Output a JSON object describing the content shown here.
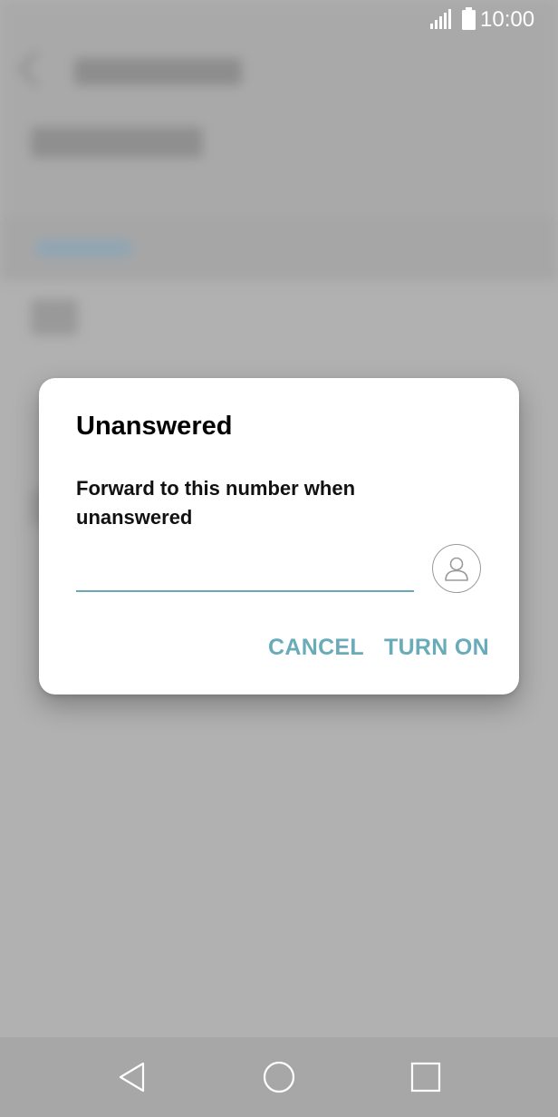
{
  "status_bar": {
    "time": "10:00",
    "signal_icon": "signal-icon",
    "battery_icon": "battery-icon"
  },
  "dialog": {
    "title": "Unanswered",
    "message": "Forward to this number when unanswered",
    "input": {
      "value": "",
      "placeholder": ""
    },
    "contact_icon": "contact-person-icon",
    "cancel_label": "CANCEL",
    "turn_on_label": "TURN ON",
    "accent_color": "#6aabb9"
  },
  "nav_bar": {
    "back_icon": "back-triangle-icon",
    "home_icon": "home-circle-icon",
    "recents_icon": "recents-square-icon"
  }
}
